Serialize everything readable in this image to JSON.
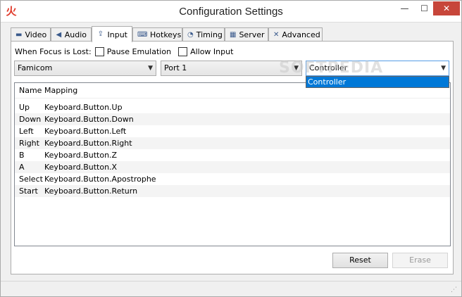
{
  "window": {
    "title": "Configuration Settings",
    "app_icon_glyph": "火",
    "minimize": "—",
    "maximize": "☐",
    "close": "✕"
  },
  "tabs": [
    {
      "label": "Video",
      "icon": "monitor-icon",
      "glyph": "▬"
    },
    {
      "label": "Audio",
      "icon": "speaker-icon",
      "glyph": "◀"
    },
    {
      "label": "Input",
      "icon": "input-icon",
      "glyph": "⇪"
    },
    {
      "label": "Hotkeys",
      "icon": "keyboard-icon",
      "glyph": "⌨"
    },
    {
      "label": "Timing",
      "icon": "clock-icon",
      "glyph": "◔"
    },
    {
      "label": "Server",
      "icon": "server-icon",
      "glyph": "▦"
    },
    {
      "label": "Advanced",
      "icon": "tools-icon",
      "glyph": "✕"
    }
  ],
  "active_tab": "Input",
  "focus": {
    "label": "When Focus is Lost:",
    "pause_emulation": "Pause Emulation",
    "allow_input": "Allow Input"
  },
  "combos": {
    "system": "Famicom",
    "port": "Port 1",
    "device": "Controller",
    "device_options": [
      "Controller"
    ]
  },
  "table": {
    "headers": {
      "name": "Name",
      "mapping": "Mapping"
    },
    "rows": [
      {
        "name": "Up",
        "mapping": "Keyboard.Button.Up"
      },
      {
        "name": "Down",
        "mapping": "Keyboard.Button.Down"
      },
      {
        "name": "Left",
        "mapping": "Keyboard.Button.Left"
      },
      {
        "name": "Right",
        "mapping": "Keyboard.Button.Right"
      },
      {
        "name": "B",
        "mapping": "Keyboard.Button.Z"
      },
      {
        "name": "A",
        "mapping": "Keyboard.Button.X"
      },
      {
        "name": "Select",
        "mapping": "Keyboard.Button.Apostrophe"
      },
      {
        "name": "Start",
        "mapping": "Keyboard.Button.Return"
      }
    ]
  },
  "buttons": {
    "reset": "Reset",
    "erase": "Erase"
  },
  "watermark": "SOFTPEDIA",
  "colors": {
    "selection": "#0078d7",
    "close_button": "#c7463a",
    "app_icon": "#e03a2a"
  }
}
